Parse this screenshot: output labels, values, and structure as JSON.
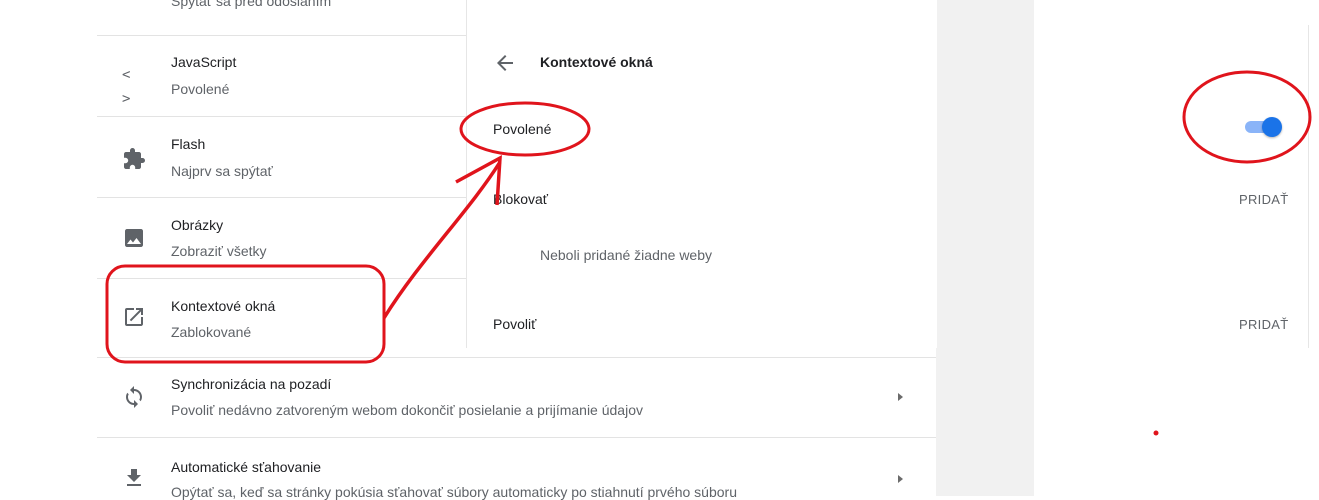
{
  "settings": {
    "top_partial_sub": "Spýtať sa pred odoslaním",
    "items": [
      {
        "title": "JavaScript",
        "sub": "Povolené",
        "icon": "code-icon"
      },
      {
        "title": "Flash",
        "sub": "Najprv sa spýtať",
        "icon": "puzzle-icon"
      },
      {
        "title": "Obrázky",
        "sub": "Zobraziť všetky",
        "icon": "image-icon"
      },
      {
        "title": "Kontextové okná",
        "sub": "Zablokované",
        "icon": "open-in-new-icon"
      },
      {
        "title": "Synchronizácia na pozadí",
        "sub": "Povoliť nedávno zatvoreným webom dokončiť posielanie a prijímanie údajov",
        "icon": "sync-icon"
      },
      {
        "title": "Automatické sťahovanie",
        "sub": "Opýtať sa, keď sa stránky pokúsia sťahovať súbory automaticky po stiahnutí prvého súboru",
        "icon": "download-icon"
      }
    ]
  },
  "popup": {
    "header_title": "Kontextové okná",
    "allowed_label": "Povolené",
    "block_label": "Blokovať",
    "no_sites": "Neboli pridané žiadne weby",
    "allow_label": "Povoliť",
    "add_label": "PRIDAŤ",
    "toggle_on": true
  },
  "annotation_color": "#e0141c",
  "accent_color": "#1a73e8"
}
